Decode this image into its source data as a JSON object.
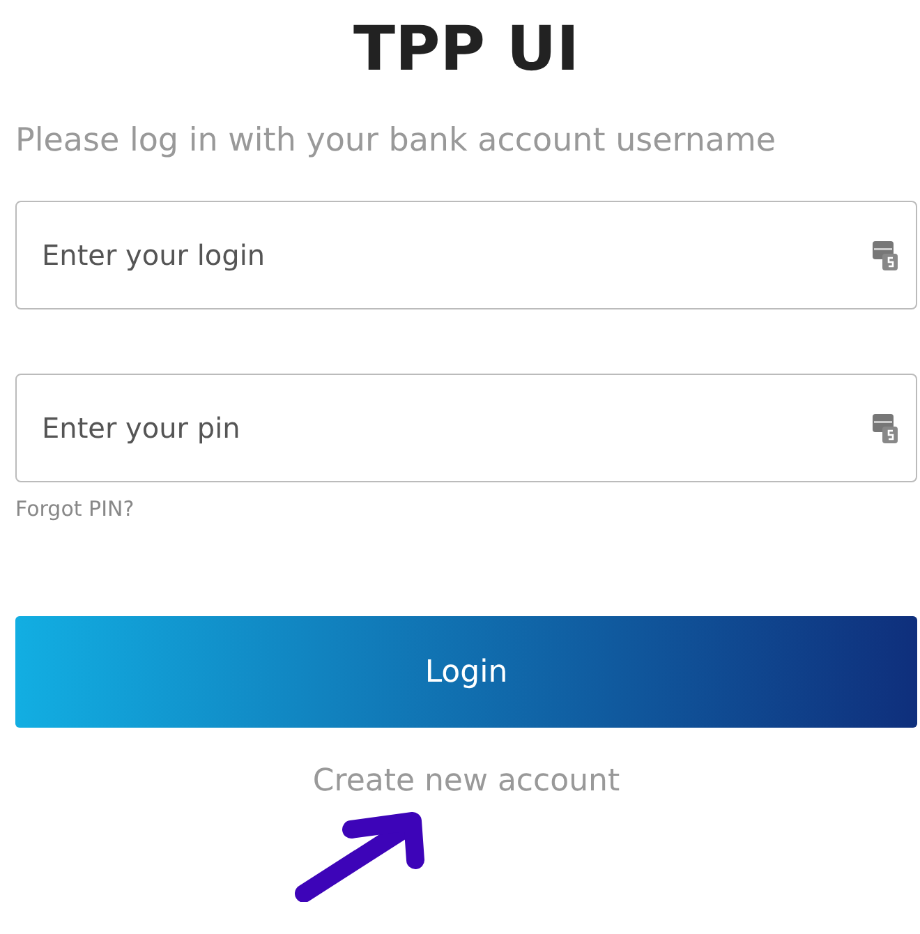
{
  "title": "TPP UI",
  "subtitle": "Please log in with your bank account username",
  "fields": [
    {
      "placeholder": "Enter your login"
    },
    {
      "placeholder": "Enter your pin"
    }
  ],
  "forgot_link": "Forgot PIN?",
  "login_button": "Login",
  "create_link": "Create new account"
}
